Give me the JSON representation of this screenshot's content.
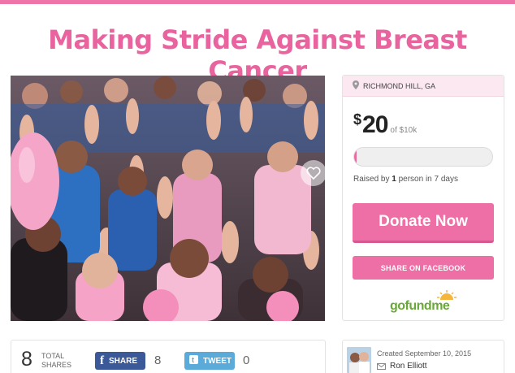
{
  "title": "Making Stride Against Breast Cancer",
  "colors": {
    "brand_pink": "#ee6ea6",
    "title_pink": "#e9649f",
    "facebook": "#3b5998",
    "twitter": "#5aabd9",
    "gofundme_green": "#6aa83a"
  },
  "campaign": {
    "location": "RICHMOND HILL, GA",
    "amount_symbol": "$",
    "amount_raised": "20",
    "goal": "of $10k",
    "progress": 0.02,
    "raised_by_prefix": "Raised by ",
    "raised_by_count": "1",
    "raised_by_suffix": " person in 7 days",
    "donate_label": "Donate Now",
    "share_facebook_label": "SHARE ON FACEBOOK",
    "logo_text": "gofundme"
  },
  "shares": {
    "total": "8",
    "total_label_line1": "TOTAL",
    "total_label_line2": "SHARES",
    "facebook_label": "SHARE",
    "facebook_count": "8",
    "twitter_label": "TWEET",
    "twitter_count": "0"
  },
  "organizer": {
    "created": "Created September 10, 2015",
    "name": "Ron Elliott"
  },
  "icons": {
    "location": "map-pin-icon",
    "heart": "heart-icon",
    "facebook": "facebook-icon",
    "twitter": "twitter-icon",
    "mail": "mail-icon"
  }
}
